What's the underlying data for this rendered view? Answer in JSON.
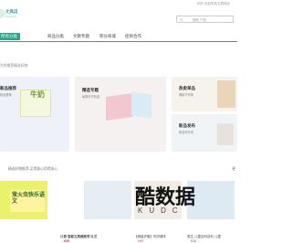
{
  "header": {
    "welcome": "你好,欢迎来到文具网店",
    "logo_name": "文具店",
    "logo_sub": "stationery",
    "search_placeholder": "搜索 产品"
  },
  "nav": {
    "items": [
      {
        "label": "所有分类"
      },
      {
        "label": "商品分类"
      },
      {
        "label": "文教专题"
      },
      {
        "label": "积分商城"
      },
      {
        "label": "招商合作"
      }
    ]
  },
  "promo_line": "为你推荐精选好物",
  "cards": {
    "card1": {
      "title": "新品推荐",
      "sub": "新品推荐"
    },
    "card2": {
      "title": "精选专题",
      "sub": "每周好书精选"
    },
    "card3": {
      "title": "热卖单品",
      "sub": "爆款不停歇"
    },
    "card4": {
      "title": "新品发布",
      "sub": "新品抢先看"
    }
  },
  "section": {
    "label": "精选好物推荐,买得放心用得安心",
    "more": "更"
  },
  "products": [
    {
      "name": "计算 智能文具快乐学习",
      "price": "¥39"
    },
    {
      "name": "计算 智能文具画图书 儿童",
      "price": "¥29"
    },
    {
      "name": "【精装护套】同济课本",
      "price": "¥99"
    },
    {
      "name": "语文 儿童百科百科 儿童",
      "price": "¥26"
    }
  ],
  "book_text": {
    "milk": "牛奶",
    "book": "萤火虫快乐语文"
  },
  "watermark": {
    "title": "酷数据",
    "sub": "KUDC"
  },
  "colors": {
    "accent": "#2aa58c",
    "price": "#e33333"
  }
}
